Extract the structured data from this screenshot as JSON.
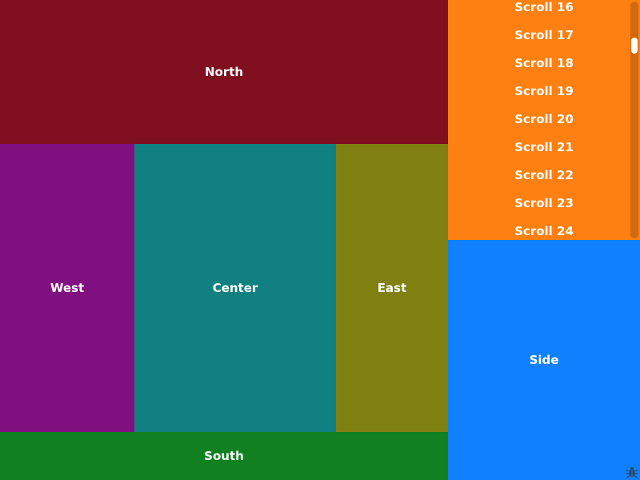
{
  "colors": {
    "north": "#800f20",
    "west": "#801080",
    "center": "#118080",
    "east": "#808010",
    "south": "#118020",
    "side": "#1180ff",
    "scroll": "#ff8012"
  },
  "regions": {
    "north": "North",
    "west": "West",
    "center": "Center",
    "east": "East",
    "south": "South",
    "side": "Side"
  },
  "scroll_items": [
    "Scroll 16",
    "Scroll 17",
    "Scroll 18",
    "Scroll 19",
    "Scroll 20",
    "Scroll 21",
    "Scroll 22",
    "Scroll 23",
    "Scroll 24"
  ],
  "icons": {
    "corner": "bug-icon"
  }
}
